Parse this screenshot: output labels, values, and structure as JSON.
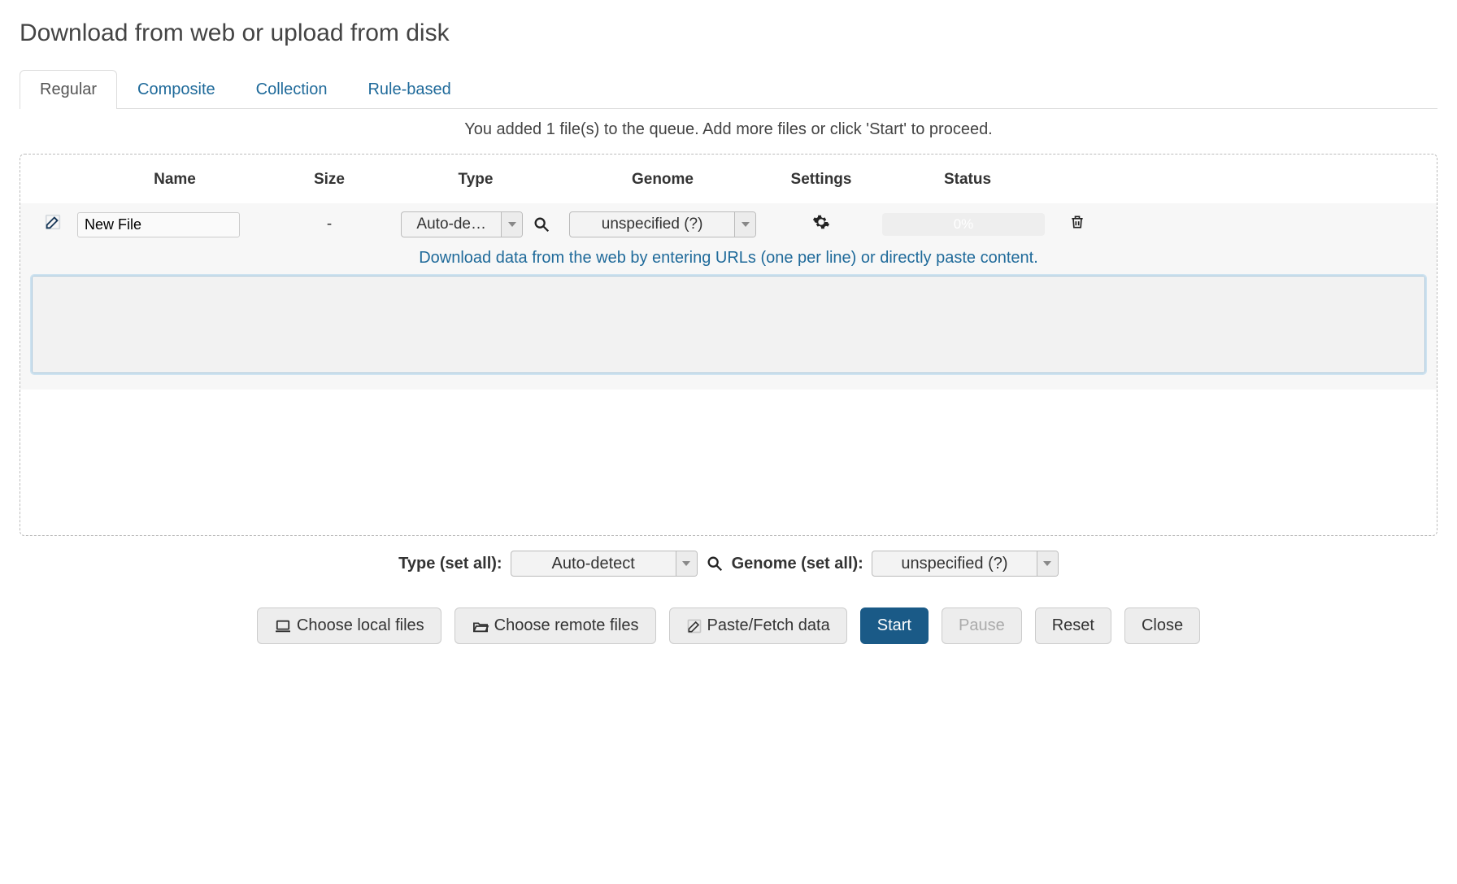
{
  "title": "Download from web or upload from disk",
  "tabs": [
    "Regular",
    "Composite",
    "Collection",
    "Rule-based"
  ],
  "queue_message": "You added 1 file(s) to the queue. Add more files or click 'Start' to proceed.",
  "headers": {
    "name": "Name",
    "size": "Size",
    "type": "Type",
    "genome": "Genome",
    "settings": "Settings",
    "status": "Status"
  },
  "row": {
    "name_value": "New File",
    "size": "-",
    "type_value": "Auto-de…",
    "genome_value": "unspecified (?)",
    "progress": "0%"
  },
  "paste_hint": "Download data from the web by entering URLs (one per line) or directly paste content.",
  "setall": {
    "type_label": "Type (set all):",
    "type_value": "Auto-detect",
    "genome_label": "Genome (set all):",
    "genome_value": "unspecified (?)"
  },
  "buttons": {
    "choose_local": "Choose local files",
    "choose_remote": "Choose remote files",
    "paste_fetch": "Paste/Fetch data",
    "start": "Start",
    "pause": "Pause",
    "reset": "Reset",
    "close": "Close"
  }
}
